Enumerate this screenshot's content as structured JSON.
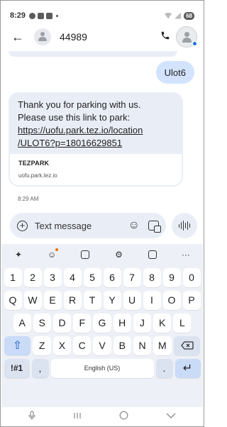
{
  "status_bar": {
    "time": "8:29",
    "battery": "68"
  },
  "header": {
    "back_icon": "arrow-left-icon",
    "contact_name": "44989",
    "call_icon": "phone-icon"
  },
  "conversation": {
    "sent_message": "Ulot6",
    "received_message": {
      "line1": "Thank you for parking with us.",
      "line2": "Please use this link to park:",
      "link_line1": "https://uofu.park.tez.io/location",
      "link_line2": "/ULOT6?p=18016629851"
    },
    "link_preview": {
      "title": "TEZPARK",
      "domain": "uofu.park.tez.io"
    },
    "timestamp": "8:29 AM"
  },
  "compose": {
    "placeholder": "Text message",
    "add_icon": "plus-icon",
    "emoji_icon": "emoji-icon",
    "gallery_icon": "gallery-icon",
    "voice_icon": "voice-wave-icon"
  },
  "keyboard": {
    "toolbar_icons": [
      "sparkle-icon",
      "sticker-icon",
      "clipboard-icon",
      "settings-icon",
      "text-edit-icon",
      "more-icon"
    ],
    "row_numbers": [
      "1",
      "2",
      "3",
      "4",
      "5",
      "6",
      "7",
      "8",
      "9",
      "0"
    ],
    "row_top": [
      "Q",
      "W",
      "E",
      "R",
      "T",
      "Y",
      "U",
      "I",
      "O",
      "P"
    ],
    "row_middle": [
      "A",
      "S",
      "D",
      "F",
      "G",
      "H",
      "J",
      "K",
      "L"
    ],
    "row_bottom": [
      "Z",
      "X",
      "C",
      "V",
      "B",
      "N",
      "M"
    ],
    "symbols_label": "!#1",
    "comma": ",",
    "space_label": "English (US)",
    "period": "."
  },
  "nav": {
    "icons": [
      "mic-icon",
      "recents-icon",
      "home-icon",
      "back-icon"
    ]
  },
  "colors": {
    "sent_bubble": "#d3e3fd",
    "received_bubble": "#e9eef6",
    "keyboard_bg": "#edf0f6",
    "accent": "#1a73e8"
  }
}
